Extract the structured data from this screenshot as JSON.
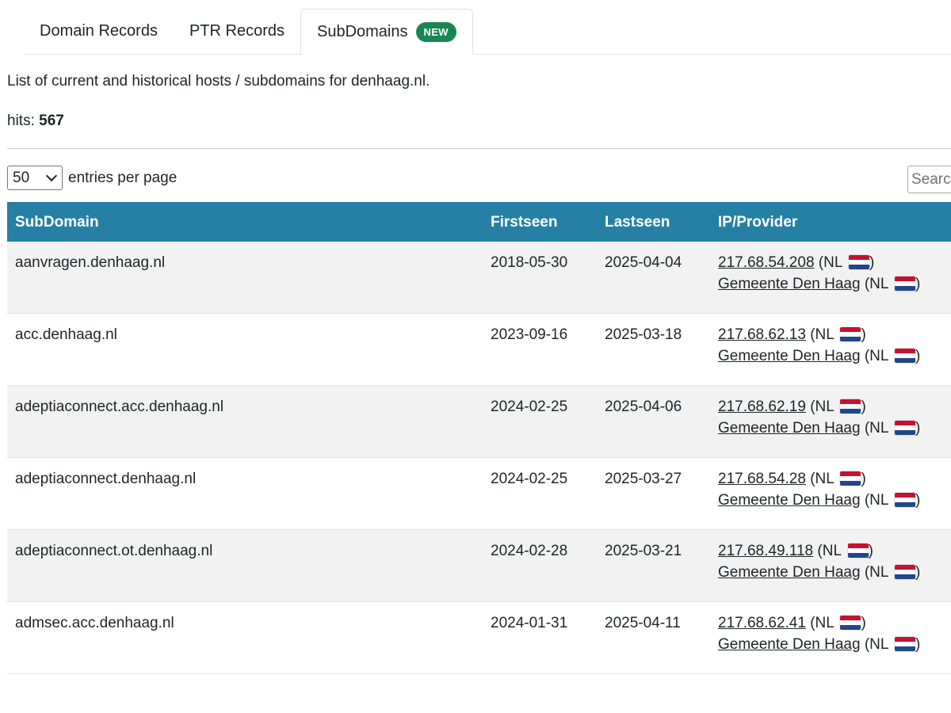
{
  "tabs": [
    {
      "label": "Domain Records"
    },
    {
      "label": "PTR Records"
    },
    {
      "label": "SubDomains",
      "badge": "NEW"
    }
  ],
  "description": "List of current and historical hosts / subdomains for denhaag.nl.",
  "hits": {
    "label": "hits:",
    "value": "567"
  },
  "entries": {
    "selected": "50",
    "suffix": "entries per page"
  },
  "search": {
    "placeholder": "Search..."
  },
  "table": {
    "headers": {
      "subdomain": "SubDomain",
      "firstseen": "Firstseen",
      "lastseen": "Lastseen",
      "ip_provider": "IP/Provider"
    },
    "rows": [
      {
        "subdomain": "aanvragen.denhaag.nl",
        "firstseen": "2018-05-30",
        "lastseen": "2025-04-04",
        "ip": "217.68.54.208",
        "ip_cc": "(NL",
        "ip_close": ")",
        "provider": "Gemeente Den Haag",
        "prov_cc": "(NL",
        "prov_close": ")"
      },
      {
        "subdomain": "acc.denhaag.nl",
        "firstseen": "2023-09-16",
        "lastseen": "2025-03-18",
        "ip": "217.68.62.13",
        "ip_cc": "(NL",
        "ip_close": ")",
        "provider": "Gemeente Den Haag",
        "prov_cc": "(NL",
        "prov_close": ")"
      },
      {
        "subdomain": "adeptiaconnect.acc.denhaag.nl",
        "firstseen": "2024-02-25",
        "lastseen": "2025-04-06",
        "ip": "217.68.62.19",
        "ip_cc": "(NL",
        "ip_close": ")",
        "provider": "Gemeente Den Haag",
        "prov_cc": "(NL",
        "prov_close": ")"
      },
      {
        "subdomain": "adeptiaconnect.denhaag.nl",
        "firstseen": "2024-02-25",
        "lastseen": "2025-03-27",
        "ip": "217.68.54.28",
        "ip_cc": "(NL",
        "ip_close": ")",
        "provider": "Gemeente Den Haag",
        "prov_cc": "(NL",
        "prov_close": ")"
      },
      {
        "subdomain": "adeptiaconnect.ot.denhaag.nl",
        "firstseen": "2024-02-28",
        "lastseen": "2025-03-21",
        "ip": "217.68.49.118",
        "ip_cc": "(NL",
        "ip_close": ")",
        "provider": "Gemeente Den Haag",
        "prov_cc": "(NL",
        "prov_close": ")"
      },
      {
        "subdomain": "admsec.acc.denhaag.nl",
        "firstseen": "2024-01-31",
        "lastseen": "2025-04-11",
        "ip": "217.68.62.41",
        "ip_cc": "(NL",
        "ip_close": ")",
        "provider": "Gemeente Den Haag",
        "prov_cc": "(NL",
        "prov_close": ")"
      }
    ]
  },
  "colors": {
    "header_bg": "#2680a5",
    "badge_bg": "#198754",
    "row_alt": "#f2f2f2",
    "flag_red": "#c8102e",
    "flag_blue": "#21468b"
  },
  "icons": {
    "flag": "netherlands-flag-icon",
    "select": "chevron-down-icon"
  }
}
